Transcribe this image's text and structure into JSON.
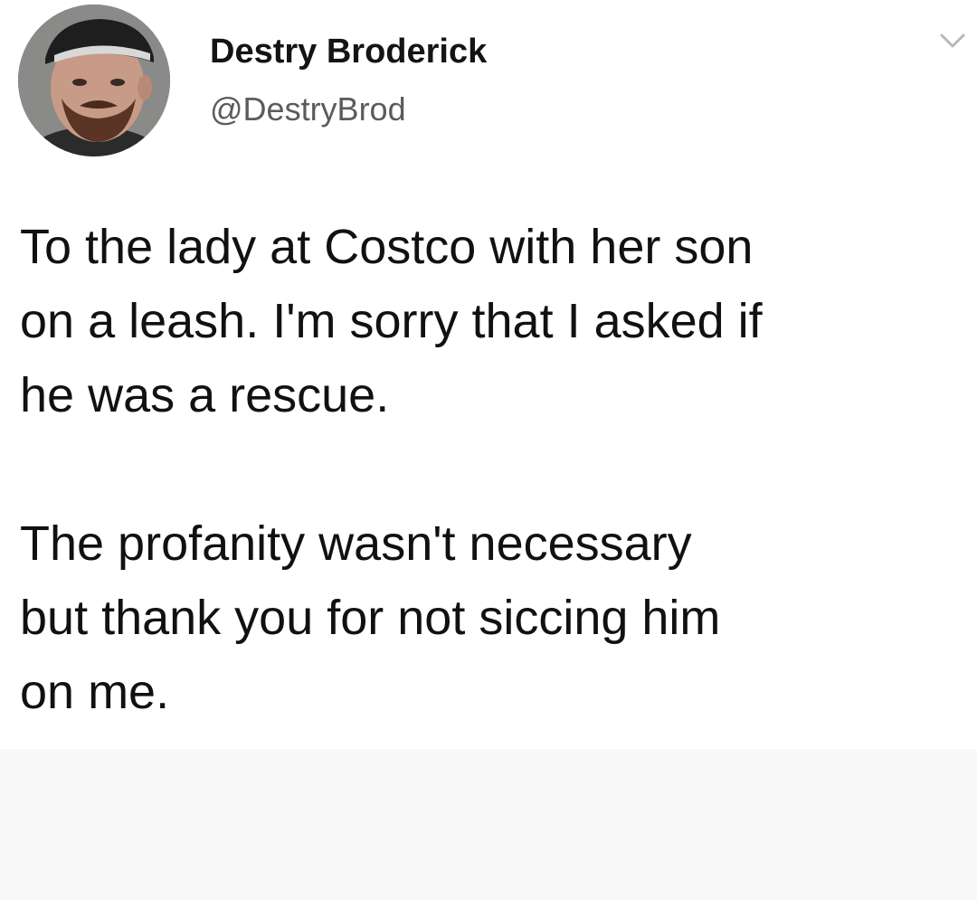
{
  "author": {
    "name": "Destry Broderick",
    "handle": "@DestryBrod"
  },
  "icons": {
    "avatar": "profile-photo",
    "menu": "chevron-down-icon"
  },
  "tweet": {
    "paragraph_1_lines": [
      "To the lady at Costco with her son",
      "on a leash. I'm sorry that I asked if",
      "he was a rescue."
    ],
    "paragraph_2_lines": [
      "The profanity wasn't necessary",
      "but thank you for not siccing him",
      "on me."
    ]
  },
  "colors": {
    "text": "#111111",
    "handle": "#5b5b5b",
    "background": "#ffffff",
    "chevron": "#b9b9b9"
  }
}
